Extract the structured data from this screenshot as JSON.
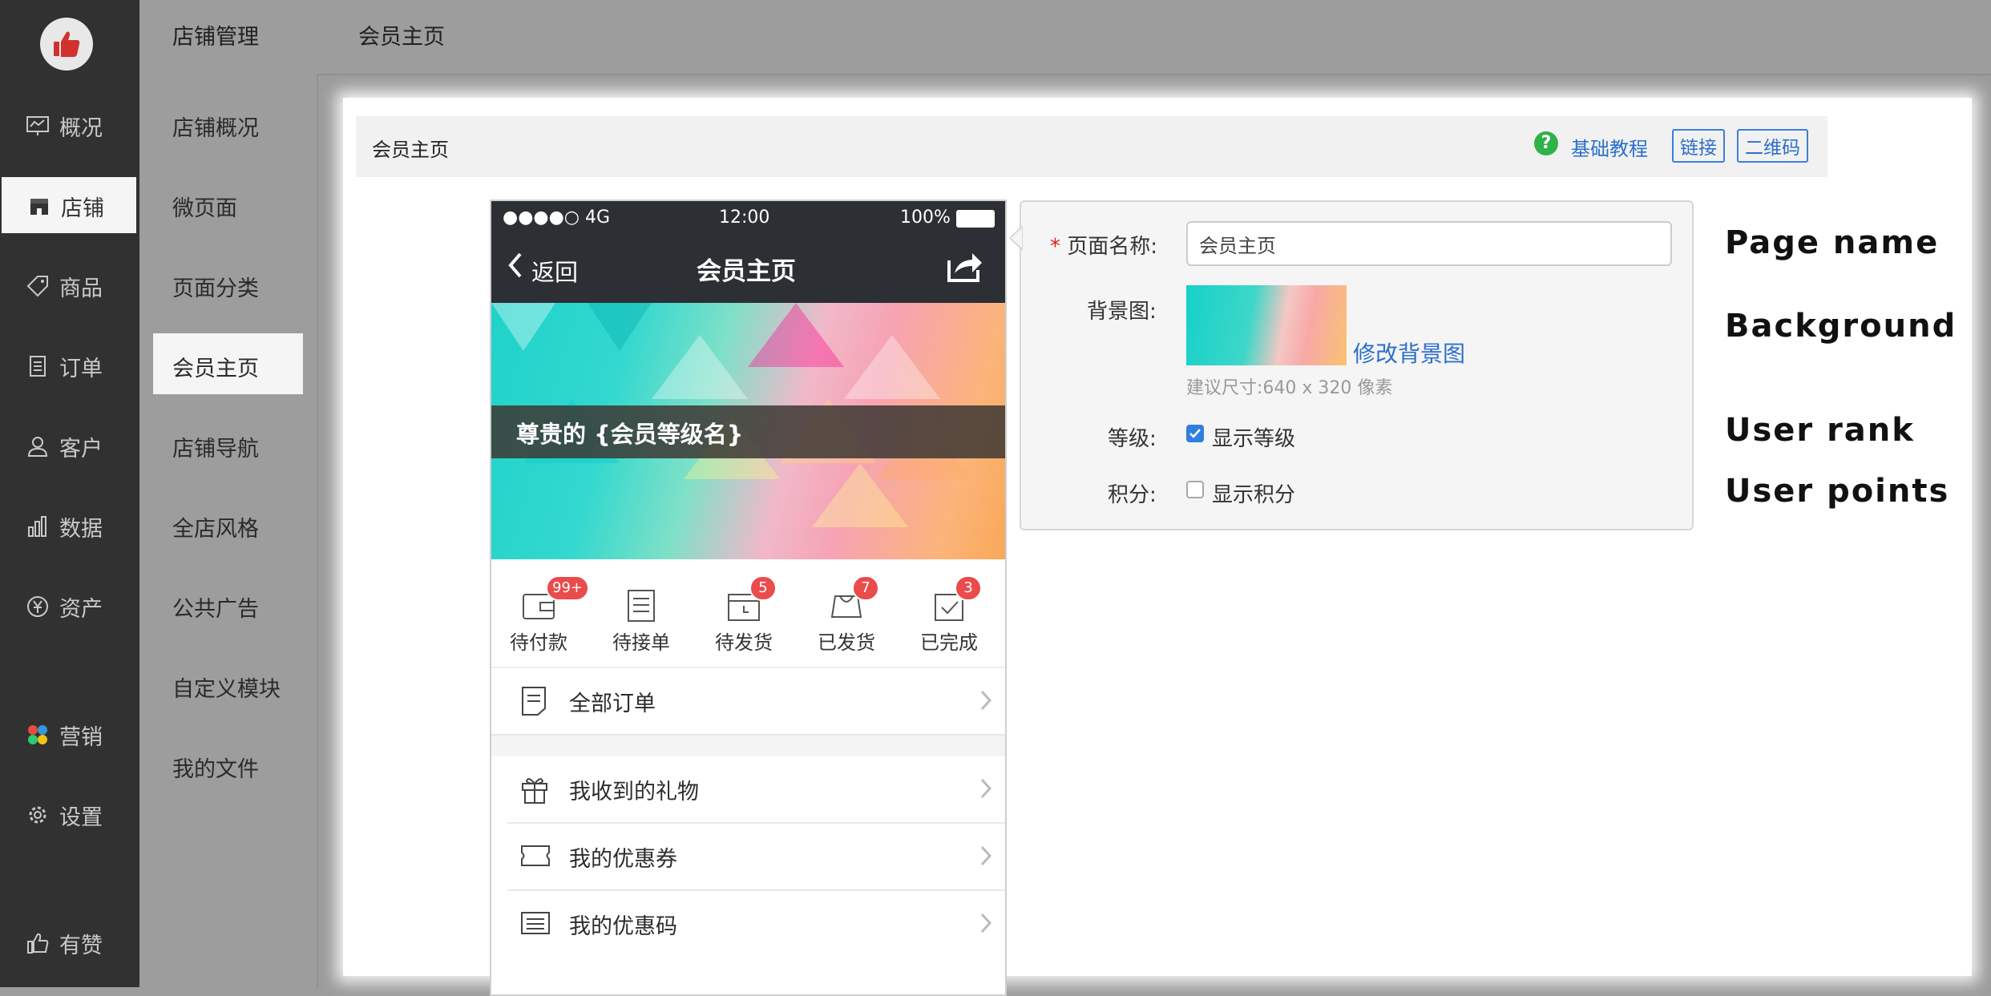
{
  "sidebar": {
    "items": [
      {
        "icon": "chart-icon",
        "label": "概况"
      },
      {
        "icon": "store-icon",
        "label": "店铺"
      },
      {
        "icon": "tag-icon",
        "label": "商品"
      },
      {
        "icon": "document-icon",
        "label": "订单"
      },
      {
        "icon": "user-icon",
        "label": "客户"
      },
      {
        "icon": "bar-chart-icon",
        "label": "数据"
      },
      {
        "icon": "yen-icon",
        "label": "资产"
      },
      {
        "icon": "colorful-clover-icon",
        "label": "营销"
      },
      {
        "icon": "gear-icon",
        "label": "设置"
      },
      {
        "icon": "thumbs-up-icon",
        "label": "有赞"
      }
    ]
  },
  "subnav": {
    "title": "店铺管理",
    "items": [
      "店铺概况",
      "微页面",
      "页面分类",
      "会员主页",
      "店铺导航",
      "全店风格",
      "公共广告",
      "自定义模块",
      "我的文件"
    ]
  },
  "header": {
    "title": "会员主页"
  },
  "breadcrumb": {
    "title": "会员主页",
    "help_label": "基础教程",
    "link_button": "链接",
    "qrcode_button": "二维码"
  },
  "phone": {
    "status_left": "●●●●○ 4G",
    "time": "12:00",
    "battery": "100%",
    "back_label": "返回",
    "title": "会员主页",
    "hero_text": "尊贵的 {会员等级名}",
    "orders": [
      {
        "label": "待付款",
        "badge": "99+",
        "icon": "wallet-icon"
      },
      {
        "label": "待接单",
        "badge": "",
        "icon": "list-icon"
      },
      {
        "label": "待发货",
        "badge": "5",
        "icon": "box-clock-icon"
      },
      {
        "label": "已发货",
        "badge": "7",
        "icon": "truck-icon"
      },
      {
        "label": "已完成",
        "badge": "3",
        "icon": "check-doc-icon"
      }
    ],
    "rows": [
      {
        "label": "全部订单",
        "icon": "order-doc-icon"
      },
      {
        "label": "我收到的礼物",
        "icon": "gift-icon"
      },
      {
        "label": "我的优惠券",
        "icon": "ticket-icon"
      },
      {
        "label": "我的优惠码",
        "icon": "code-list-icon"
      }
    ]
  },
  "form": {
    "name_label": "页面名称:",
    "name_value": "会员主页",
    "bg_label": "背景图:",
    "bg_change": "修改背景图",
    "bg_hint": "建议尺寸:640 x 320 像素",
    "rank_label": "等级:",
    "rank_checkbox": "显示等级",
    "rank_checked": true,
    "points_label": "积分:",
    "points_checkbox": "显示积分",
    "points_checked": false
  },
  "annotations": [
    "Page name",
    "Background",
    "User rank",
    "User points"
  ],
  "colors": {
    "accent": "#2f7fe0",
    "sidebar_bg": "#313131",
    "badge": "#ea4b4b",
    "phone_header": "#2c2f33"
  }
}
